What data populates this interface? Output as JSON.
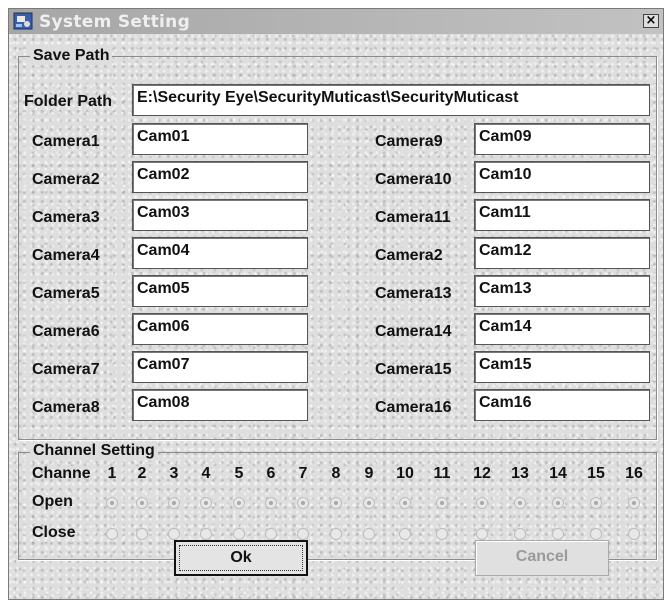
{
  "window": {
    "title": "System Setting",
    "close_glyph": "×"
  },
  "save_path": {
    "legend": "Save Path",
    "folder_label": "Folder Path",
    "folder_value": "E:\\Security Eye\\SecurityMuticast\\SecurityMuticast",
    "cameras_left": [
      {
        "label": "Camera1",
        "value": "Cam01"
      },
      {
        "label": "Camera2",
        "value": "Cam02"
      },
      {
        "label": "Camera3",
        "value": "Cam03"
      },
      {
        "label": "Camera4",
        "value": "Cam04"
      },
      {
        "label": "Camera5",
        "value": "Cam05"
      },
      {
        "label": "Camera6",
        "value": "Cam06"
      },
      {
        "label": "Camera7",
        "value": "Cam07"
      },
      {
        "label": "Camera8",
        "value": "Cam08"
      }
    ],
    "cameras_right": [
      {
        "label": "Camera9",
        "value": "Cam09"
      },
      {
        "label": "Camera10",
        "value": "Cam10"
      },
      {
        "label": "Camera11",
        "value": "Cam11"
      },
      {
        "label": "Camera2",
        "value": "Cam12"
      },
      {
        "label": "Camera13",
        "value": "Cam13"
      },
      {
        "label": "Camera14",
        "value": "Cam14"
      },
      {
        "label": "Camera15",
        "value": "Cam15"
      },
      {
        "label": "Camera16",
        "value": "Cam16"
      }
    ]
  },
  "channel_setting": {
    "legend": "Channel Setting",
    "channel_label": "Channe",
    "open_label": "Open",
    "close_label": "Close",
    "channels": [
      "1",
      "2",
      "3",
      "4",
      "5",
      "6",
      "7",
      "8",
      "9",
      "10",
      "11",
      "12",
      "13",
      "14",
      "15",
      "16"
    ],
    "selected": "open"
  },
  "buttons": {
    "ok": "Ok",
    "cancel": "Cancel"
  },
  "icons": {
    "app": "app-icon",
    "close": "close-icon",
    "radio": "radio-icon"
  }
}
